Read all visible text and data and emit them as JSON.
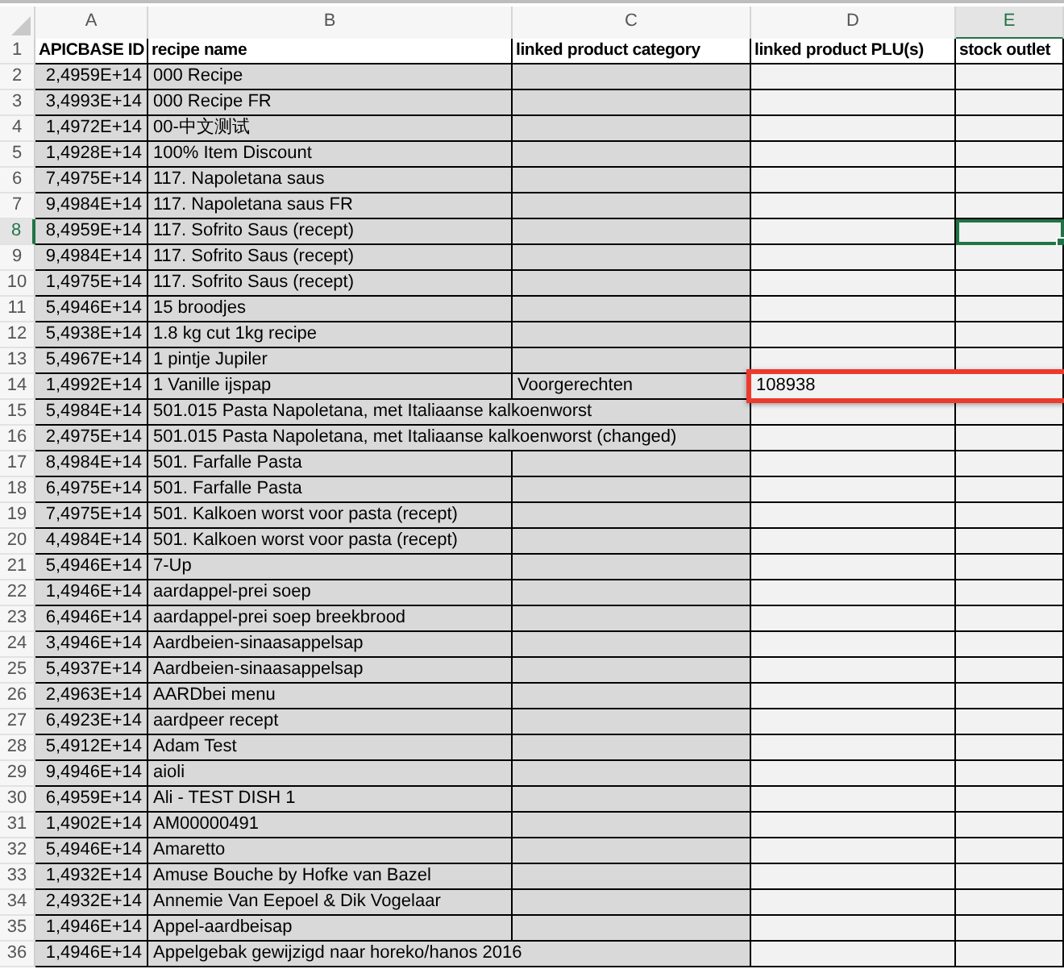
{
  "columns": [
    {
      "label": "A",
      "selected": false,
      "callout": false
    },
    {
      "label": "B",
      "selected": false,
      "callout": false
    },
    {
      "label": "C",
      "selected": false,
      "callout": false
    },
    {
      "label": "D",
      "selected": false,
      "callout": true
    },
    {
      "label": "E",
      "selected": true,
      "callout": false
    }
  ],
  "rows": [
    {
      "number": "1",
      "kind": "header",
      "selected": false,
      "callout": false,
      "cells": [
        "APICBASE ID",
        "recipe name",
        "linked product category",
        "linked product PLU(s)",
        "stock outlet"
      ]
    },
    {
      "number": "2",
      "kind": "data",
      "selected": false,
      "callout": false,
      "cells": [
        "2,4959E+14",
        "000 Recipe",
        null,
        null,
        null
      ]
    },
    {
      "number": "3",
      "kind": "data",
      "selected": false,
      "callout": false,
      "cells": [
        "3,4993E+14",
        "000 Recipe FR",
        null,
        null,
        null
      ]
    },
    {
      "number": "4",
      "kind": "data",
      "selected": false,
      "callout": false,
      "cells": [
        "1,4972E+14",
        "00-中文测试",
        null,
        null,
        null
      ]
    },
    {
      "number": "5",
      "kind": "data",
      "selected": false,
      "callout": false,
      "cells": [
        "1,4928E+14",
        "100% Item Discount",
        null,
        null,
        null
      ]
    },
    {
      "number": "6",
      "kind": "data",
      "selected": false,
      "callout": false,
      "cells": [
        "7,4975E+14",
        "117. Napoletana saus",
        null,
        null,
        null
      ]
    },
    {
      "number": "7",
      "kind": "data",
      "selected": false,
      "callout": false,
      "cells": [
        "9,4984E+14",
        "117. Napoletana saus FR",
        null,
        null,
        null
      ]
    },
    {
      "number": "8",
      "kind": "data",
      "selected": true,
      "callout": false,
      "cells": [
        "8,4959E+14",
        "117. Sofrito Saus (recept)",
        null,
        null,
        null
      ]
    },
    {
      "number": "9",
      "kind": "data",
      "selected": false,
      "callout": false,
      "cells": [
        "9,4984E+14",
        "117. Sofrito Saus (recept)",
        null,
        null,
        null
      ]
    },
    {
      "number": "10",
      "kind": "data",
      "selected": false,
      "callout": false,
      "cells": [
        "1,4975E+14",
        "117. Sofrito Saus (recept)",
        null,
        null,
        null
      ]
    },
    {
      "number": "11",
      "kind": "data",
      "selected": false,
      "callout": false,
      "cells": [
        "5,4946E+14",
        "15 broodjes",
        null,
        null,
        null
      ]
    },
    {
      "number": "12",
      "kind": "data",
      "selected": false,
      "callout": false,
      "cells": [
        "5,4938E+14",
        "1.8 kg cut 1kg recipe",
        null,
        null,
        null
      ]
    },
    {
      "number": "13",
      "kind": "data",
      "selected": false,
      "callout": false,
      "cells": [
        "5,4967E+14",
        "1 pintje Jupiler",
        null,
        null,
        null
      ]
    },
    {
      "number": "14",
      "kind": "data",
      "selected": false,
      "callout": true,
      "cells": [
        "1,4992E+14",
        "1 Vanille ijspap",
        "Voorgerechten",
        "108938",
        null
      ]
    },
    {
      "number": "15",
      "kind": "data",
      "selected": false,
      "callout": false,
      "cells": [
        "5,4984E+14",
        "501.015 Pasta Napoletana, met Italiaanse kalkoenworst",
        null,
        null,
        null
      ]
    },
    {
      "number": "16",
      "kind": "data",
      "selected": false,
      "callout": false,
      "cells": [
        "2,4975E+14",
        "501.015 Pasta Napoletana, met Italiaanse kalkoenworst (changed)",
        null,
        null,
        null
      ]
    },
    {
      "number": "17",
      "kind": "data",
      "selected": false,
      "callout": false,
      "cells": [
        "8,4984E+14",
        "501. Farfalle Pasta",
        null,
        null,
        null
      ]
    },
    {
      "number": "18",
      "kind": "data",
      "selected": false,
      "callout": false,
      "cells": [
        "6,4975E+14",
        "501. Farfalle Pasta",
        null,
        null,
        null
      ]
    },
    {
      "number": "19",
      "kind": "data",
      "selected": false,
      "callout": false,
      "cells": [
        "7,4975E+14",
        "501. Kalkoen worst voor pasta (recept)",
        null,
        null,
        null
      ]
    },
    {
      "number": "20",
      "kind": "data",
      "selected": false,
      "callout": false,
      "cells": [
        "4,4984E+14",
        "501. Kalkoen worst voor pasta (recept)",
        null,
        null,
        null
      ]
    },
    {
      "number": "21",
      "kind": "data",
      "selected": false,
      "callout": false,
      "cells": [
        "5,4946E+14",
        "7-Up",
        null,
        null,
        null
      ]
    },
    {
      "number": "22",
      "kind": "data",
      "selected": false,
      "callout": false,
      "cells": [
        "1,4946E+14",
        "aardappel-prei soep",
        null,
        null,
        null
      ]
    },
    {
      "number": "23",
      "kind": "data",
      "selected": false,
      "callout": false,
      "cells": [
        "6,4946E+14",
        "aardappel-prei soep  breekbrood",
        null,
        null,
        null
      ]
    },
    {
      "number": "24",
      "kind": "data",
      "selected": false,
      "callout": false,
      "cells": [
        "3,4946E+14",
        "Aardbeien-sinaasappelsap",
        null,
        null,
        null
      ]
    },
    {
      "number": "25",
      "kind": "data",
      "selected": false,
      "callout": false,
      "cells": [
        "5,4937E+14",
        "Aardbeien-sinaasappelsap",
        null,
        null,
        null
      ]
    },
    {
      "number": "26",
      "kind": "data",
      "selected": false,
      "callout": false,
      "cells": [
        "2,4963E+14",
        "AARDbei menu",
        null,
        null,
        null
      ]
    },
    {
      "number": "27",
      "kind": "data",
      "selected": false,
      "callout": false,
      "cells": [
        "6,4923E+14",
        "aardpeer recept",
        null,
        null,
        null
      ]
    },
    {
      "number": "28",
      "kind": "data",
      "selected": false,
      "callout": false,
      "cells": [
        "5,4912E+14",
        "Adam Test",
        null,
        null,
        null
      ]
    },
    {
      "number": "29",
      "kind": "data",
      "selected": false,
      "callout": false,
      "cells": [
        "9,4946E+14",
        "aioli",
        null,
        null,
        null
      ]
    },
    {
      "number": "30",
      "kind": "data",
      "selected": false,
      "callout": false,
      "cells": [
        "6,4959E+14",
        "Ali - TEST DISH 1",
        null,
        null,
        null
      ]
    },
    {
      "number": "31",
      "kind": "data",
      "selected": false,
      "callout": false,
      "cells": [
        "1,4902E+14",
        "AM00000491",
        null,
        null,
        null
      ]
    },
    {
      "number": "32",
      "kind": "data",
      "selected": false,
      "callout": false,
      "cells": [
        "5,4946E+14",
        "Amaretto",
        null,
        null,
        null
      ]
    },
    {
      "number": "33",
      "kind": "data",
      "selected": false,
      "callout": false,
      "cells": [
        "1,4932E+14",
        "Amuse Bouche by Hofke van Bazel",
        null,
        null,
        null
      ]
    },
    {
      "number": "34",
      "kind": "data",
      "selected": false,
      "callout": false,
      "cells": [
        "2,4932E+14",
        "Annemie Van Eepoel & Dik Vogelaar",
        null,
        null,
        null
      ]
    },
    {
      "number": "35",
      "kind": "data",
      "selected": false,
      "callout": false,
      "cells": [
        "1,4946E+14",
        "Appel-aardbeisap",
        null,
        null,
        null
      ]
    },
    {
      "number": "36",
      "kind": "data",
      "selected": false,
      "callout": false,
      "cells": [
        "1,4946E+14",
        "Appelgebak gewijzigd naar horeko/hanos 2016",
        null,
        null,
        null
      ]
    }
  ]
}
